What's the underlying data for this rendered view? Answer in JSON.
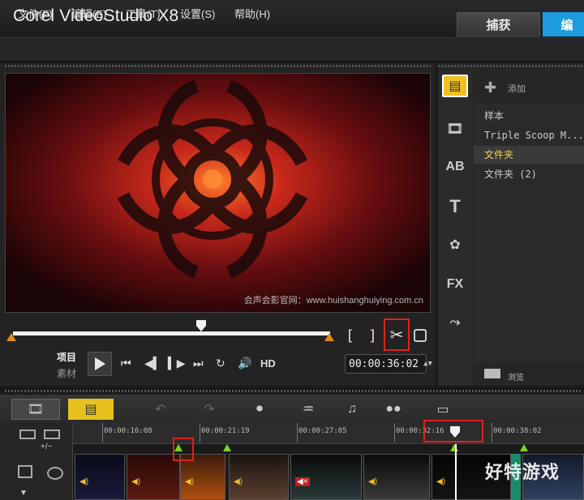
{
  "app": {
    "title": "Corel VideoStudio X8"
  },
  "tabs": [
    {
      "label": "捕获"
    },
    {
      "label": "编"
    }
  ],
  "menu": [
    {
      "label": "文件(F)"
    },
    {
      "label": "编辑(E)"
    },
    {
      "label": "工具(T)"
    },
    {
      "label": "设置(S)"
    },
    {
      "label": "帮助(H)"
    }
  ],
  "preview": {
    "watermark": "会声会影官网：www.huishanghuiying.com.cn"
  },
  "player": {
    "mode_project": "项目",
    "mode_clip": "素材",
    "hd_label": "HD",
    "timecode": "00:00:36:02",
    "mark_in": "[",
    "mark_out": "]"
  },
  "library": {
    "add_label": "添加",
    "items": [
      {
        "label": "样本"
      },
      {
        "label": "Triple Scoop M..."
      },
      {
        "label": "文件夹"
      },
      {
        "label": "文件夹 (2)"
      }
    ],
    "browse_label": "浏览"
  },
  "timeline": {
    "add_track": "+/−",
    "ticks": [
      "00:00:16:08",
      "00:00:21:19",
      "00:00:27:05",
      "00:00:32:16",
      "00:00:38:02"
    ]
  },
  "branding": {
    "text": "好特游戏"
  },
  "colors": {
    "accent": "#1d9be0",
    "highlight_box": "#e02020",
    "mark_orange": "#e08a1a",
    "marker_green": "#7ed321"
  }
}
